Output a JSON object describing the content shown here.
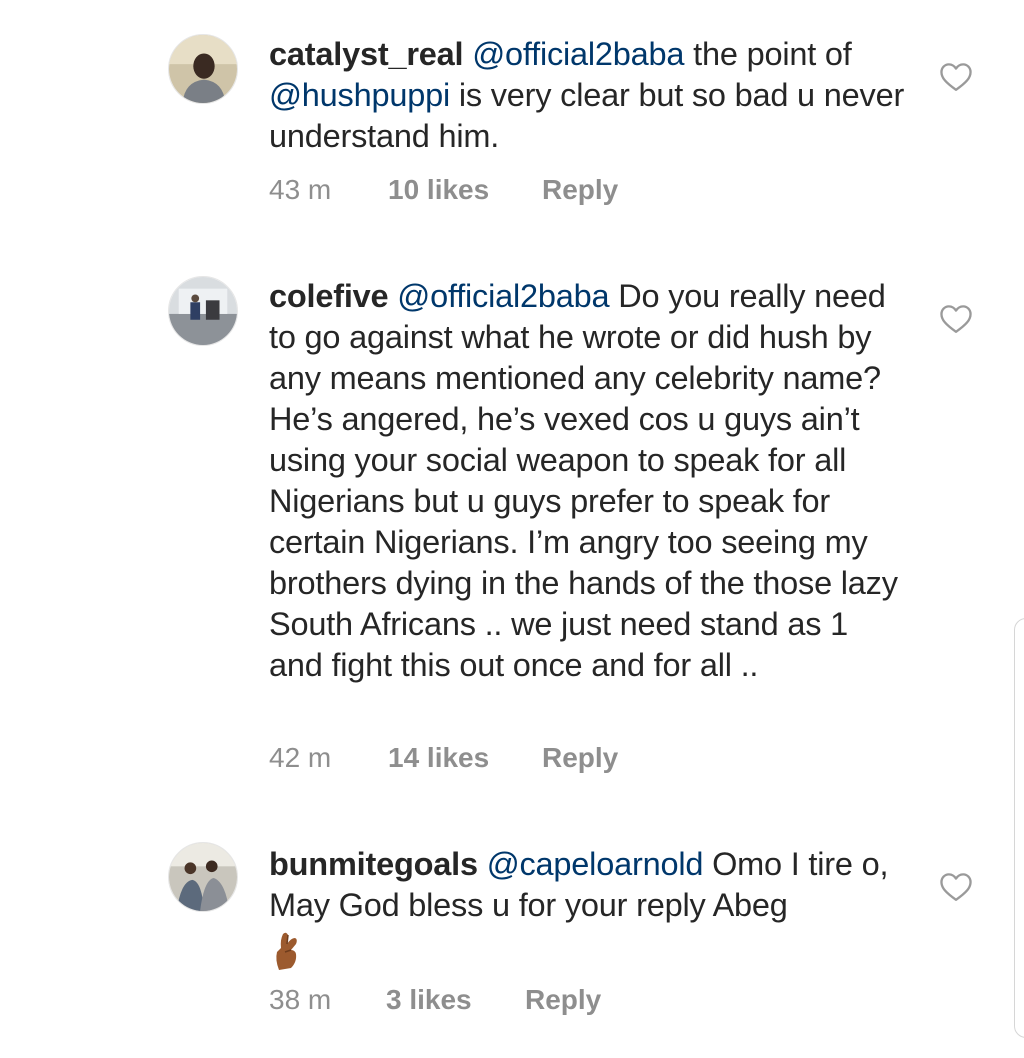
{
  "comments": [
    {
      "username": "catalyst_real",
      "mention": "@official2baba",
      "text": "the point of",
      "mention2": "@hushpuppi",
      "text2": "is very clear but so bad u never understand him.",
      "time": "43 m",
      "likes": "10 likes",
      "reply": "Reply",
      "avatar_icon": "avatar-photo",
      "heart_icon": "heart-outline-icon"
    },
    {
      "username": "colefive",
      "mention": "@official2baba",
      "text": "Do you really need to go against what he wrote or did hush by any means mentioned any celebrity name? He’s angered, he’s vexed cos u guys ain’t using your social weapon to speak for all Nigerians but u guys prefer to speak for certain Nigerians. I’m angry too seeing my brothers dying in the hands of the those lazy South Africans .. we just need stand as 1 and fight this out once and for all ..",
      "time": "42 m",
      "likes": "14 likes",
      "reply": "Reply",
      "avatar_icon": "avatar-photo",
      "heart_icon": "heart-outline-icon"
    },
    {
      "username": "bunmitegoals",
      "mention": "@capeloarnold",
      "text": "Omo I tire o, May God bless u for your reply Abeg",
      "emoji_icon": "crossed-fingers-emoji",
      "time": "38 m",
      "likes": "3 likes",
      "reply": "Reply",
      "avatar_icon": "avatar-photo",
      "heart_icon": "heart-outline-icon"
    }
  ],
  "colors": {
    "text": "#262626",
    "mention": "#00376b",
    "meta": "#8e8e8e"
  }
}
